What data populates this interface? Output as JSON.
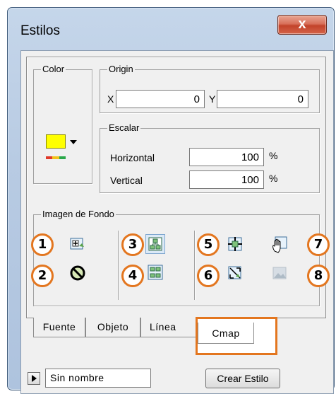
{
  "window": {
    "title": "Estilos",
    "close_glyph": "x"
  },
  "color_group": {
    "label": "Color",
    "swatch_color": "#ffff00",
    "icon": "color-picker-icon"
  },
  "origin_group": {
    "label": "Origin",
    "x_label": "X",
    "x_value": "0",
    "y_label": "Y",
    "y_value": "0"
  },
  "escalar_group": {
    "label": "Escalar",
    "horizontal_label": "Horizontal",
    "horizontal_value": "100",
    "horizontal_unit": "%",
    "vertical_label": "Vertical",
    "vertical_value": "100",
    "vertical_unit": "%"
  },
  "background_group": {
    "label": "Imagen de Fondo",
    "markers": [
      "1",
      "2",
      "3",
      "4",
      "5",
      "6",
      "7",
      "8"
    ],
    "icons": [
      "add-image-icon",
      "no-image-icon",
      "fit-layout-icon",
      "tile-layout-icon",
      "center-image-icon",
      "stretch-image-icon",
      "hand-move-icon",
      "disabled-image-icon"
    ]
  },
  "tabs": [
    "Fuente",
    "Objeto",
    "Línea",
    "Cmap"
  ],
  "active_tab": "Cmap",
  "bottom": {
    "style_name": "Sin nombre",
    "create_button": "Crear Estilo"
  },
  "accent_color": "#e3761f"
}
